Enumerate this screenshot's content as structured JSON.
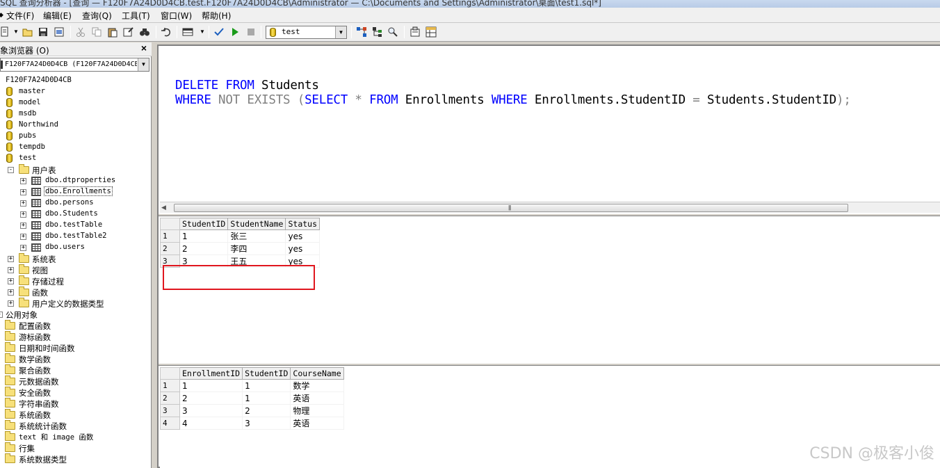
{
  "window": {
    "title": "SQL 查询分析器 - [查询 — F120F7A24D0D4CB.test.F120F7A24D0D4CB\\Administrator — C:\\Documents and Settings\\Administrator\\桌面\\test1.sql*]"
  },
  "menu": [
    "文件(F)",
    "编辑(E)",
    "查询(Q)",
    "工具(T)",
    "窗口(W)",
    "帮助(H)"
  ],
  "toolbar": {
    "database": "test"
  },
  "object_browser": {
    "title": "象浏览器 (O)",
    "close": "×",
    "server_select": "F120F7A24D0D4CB (F120F7A24D0D4CB\\Administrator)",
    "server": "F120F7A24D0D4CB",
    "databases": [
      "master",
      "model",
      "msdb",
      "Northwind",
      "pubs",
      "tempdb",
      "test"
    ],
    "test_children": {
      "user_tables_label": "用户表",
      "tables": [
        "dbo.dtproperties",
        "dbo.Enrollments",
        "dbo.persons",
        "dbo.Students",
        "dbo.testTable",
        "dbo.testTable2",
        "dbo.users"
      ],
      "folders": [
        "系统表",
        "视图",
        "存储过程",
        "函数",
        "用户定义的数据类型"
      ]
    },
    "common_objects_label": "公用对象",
    "common_objects": [
      "配置函数",
      "游标函数",
      "日期和时间函数",
      "数学函数",
      "聚合函数",
      "元数据函数",
      "安全函数",
      "字符串函数",
      "系统函数",
      "系统统计函数",
      "text 和 image 函数",
      "行集",
      "系统数据类型"
    ]
  },
  "editor": {
    "line1": {
      "kw1": "DELETE",
      "kw2": "FROM",
      "t1": "Students"
    },
    "line2": {
      "kw1": "WHERE",
      "g1": "NOT EXISTS (",
      "kw2": "SELECT",
      "g2": "*",
      "kw3": "FROM",
      "t1": "Enrollments",
      "kw4": "WHERE",
      "t2": "Enrollments.StudentID",
      "g3": "=",
      "t3": "Students.StudentID",
      "g4": ");"
    }
  },
  "results": [
    {
      "columns": [
        "StudentID",
        "StudentName",
        "Status"
      ],
      "rows": [
        {
          "n": "1",
          "cells": [
            "1",
            "张三",
            "yes"
          ]
        },
        {
          "n": "2",
          "cells": [
            "2",
            "李四",
            "yes"
          ]
        },
        {
          "n": "3",
          "cells": [
            "3",
            "王五",
            "yes"
          ]
        }
      ]
    },
    {
      "columns": [
        "EnrollmentID",
        "StudentID",
        "CourseName"
      ],
      "rows": [
        {
          "n": "1",
          "cells": [
            "1",
            "1",
            "数学"
          ]
        },
        {
          "n": "2",
          "cells": [
            "2",
            "1",
            "英语"
          ]
        },
        {
          "n": "3",
          "cells": [
            "3",
            "2",
            "物理"
          ]
        },
        {
          "n": "4",
          "cells": [
            "4",
            "3",
            "英语"
          ]
        }
      ]
    }
  ],
  "watermark": "CSDN @极客小俊",
  "colors": {
    "keyword": "#0000ff",
    "operator": "#808080",
    "highlight_box": "#e0161e"
  }
}
